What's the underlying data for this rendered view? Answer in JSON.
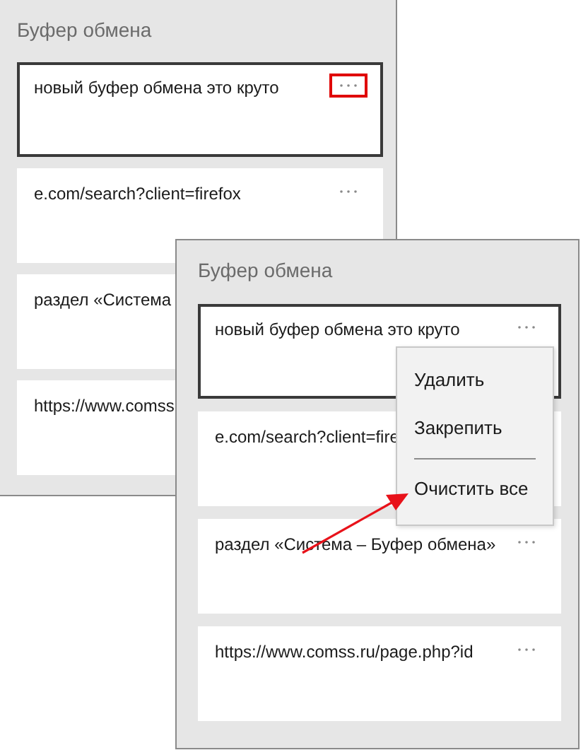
{
  "windows": [
    {
      "title": "Буфер обмена",
      "items": [
        {
          "text": "новый буфер обмена это круто",
          "selected": true,
          "more_button": true,
          "more_highlighted": true
        },
        {
          "text": "e.com/search?client=firefox",
          "selected": false,
          "more_button": true,
          "more_highlighted": false
        },
        {
          "text": "раздел «Система",
          "selected": false,
          "more_button": false
        },
        {
          "text": "https://www.comss",
          "selected": false,
          "more_button": false
        }
      ]
    },
    {
      "title": "Буфер обмена",
      "items": [
        {
          "text": "новый буфер обмена это круто",
          "selected": true,
          "more_button": true,
          "more_highlighted": false
        },
        {
          "text": "e.com/search?client=fire",
          "selected": false,
          "more_button": false
        },
        {
          "text": "раздел «Система – Буфер обмена»",
          "selected": false,
          "more_button": true,
          "more_highlighted": false
        },
        {
          "text": "https://www.comss.ru/page.php?id",
          "selected": false,
          "more_button": true,
          "more_highlighted": false
        }
      ]
    }
  ],
  "context_menu": {
    "items": [
      {
        "label": "Удалить",
        "kind": "item"
      },
      {
        "label": "Закрепить",
        "kind": "item"
      },
      {
        "kind": "divider"
      },
      {
        "label": "Очистить все",
        "kind": "item"
      }
    ]
  }
}
